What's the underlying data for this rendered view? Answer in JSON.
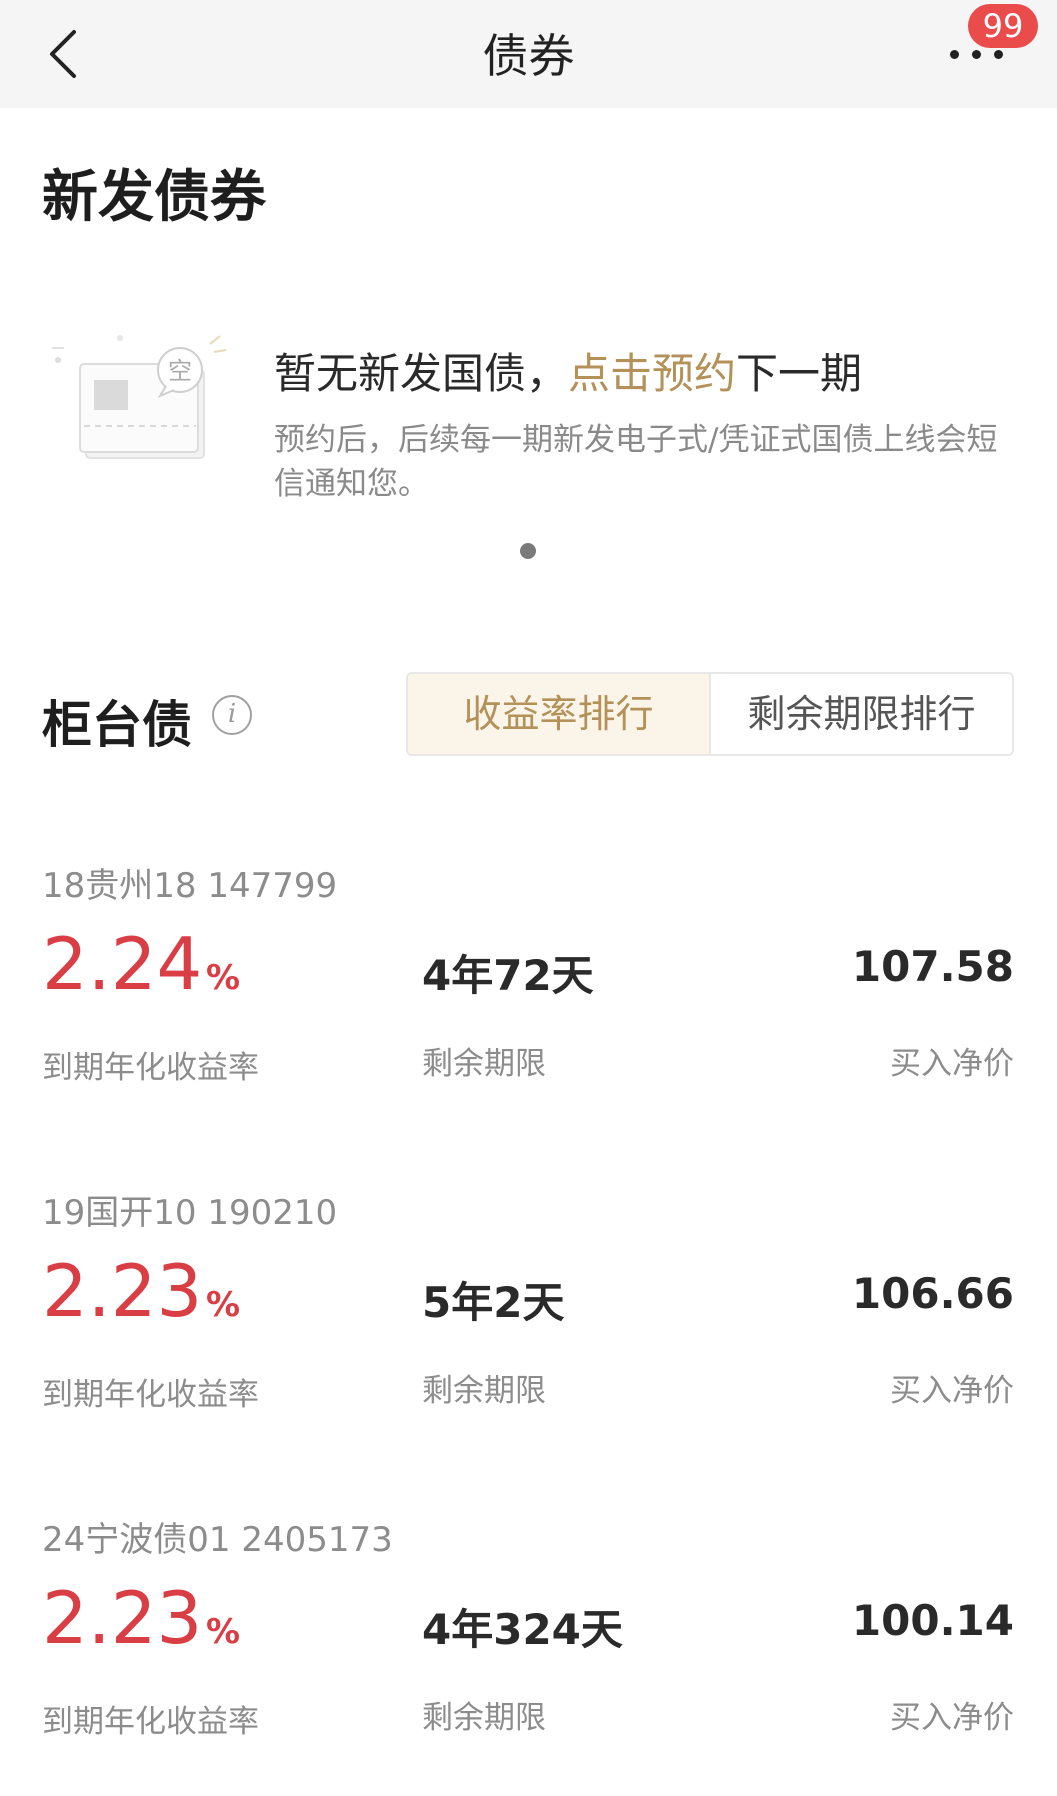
{
  "nav": {
    "title": "债券",
    "badge": "99"
  },
  "new_bonds": {
    "title": "新发债券",
    "illustration_label": "空",
    "headline_prefix": "暂无新发国债，",
    "headline_link": "点击预约",
    "headline_suffix": "下一期",
    "description": "预约后，后续每一期新发电子式/凭证式国债上线会短信通知您。"
  },
  "counter_bonds": {
    "title": "柜台债",
    "info_icon": "i",
    "tabs": [
      {
        "label": "收益率排行",
        "active": true
      },
      {
        "label": "剩余期限排行",
        "active": false
      }
    ]
  },
  "bonds": [
    {
      "name": "18贵州18 147799",
      "rate": "2.24",
      "pct": "%",
      "rate_label": "到期年化收益率",
      "term": "4年72天",
      "term_label": "剩余期限",
      "price": "107.58",
      "price_label": "买入净价"
    },
    {
      "name": "19国开10 190210",
      "rate": "2.23",
      "pct": "%",
      "rate_label": "到期年化收益率",
      "term": "5年2天",
      "term_label": "剩余期限",
      "price": "106.66",
      "price_label": "买入净价"
    },
    {
      "name": "24宁波债01 2405173",
      "rate": "2.23",
      "pct": "%",
      "rate_label": "到期年化收益率",
      "term": "4年324天",
      "term_label": "剩余期限",
      "price": "100.14",
      "price_label": "买入净价"
    }
  ],
  "colors": {
    "accent_gold": "#b39158",
    "rate_red": "#d93e45",
    "badge_red": "#ea4b4b"
  }
}
